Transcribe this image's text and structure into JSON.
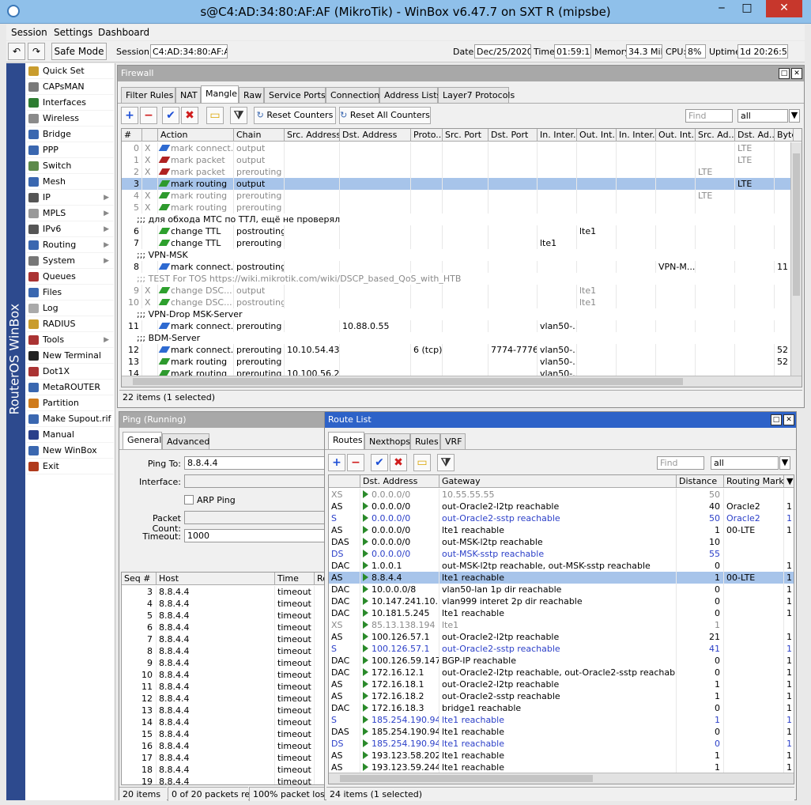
{
  "window": {
    "title": "s@C4:AD:34:80:AF:AF (MikroTik) - WinBox v6.47.7 on SXT R (mipsbe)"
  },
  "menu": [
    "Session",
    "Settings",
    "Dashboard"
  ],
  "toolbar": {
    "safe_mode": "Safe Mode",
    "session_label": "Session:",
    "session_value": "C4:AD:34:80:AF:AF",
    "date_label": "Date:",
    "date_value": "Dec/25/2020",
    "time_label": "Time:",
    "time_value": "01:59:14",
    "memory_label": "Memory:",
    "memory_value": "34.3 MiB",
    "cpu_label": "CPU:",
    "cpu_value": "8%",
    "uptime_label": "Uptime:",
    "uptime_value": "1d 20:26:52"
  },
  "sidebar": {
    "brand": "RouterOS WinBox",
    "items": [
      {
        "label": "Quick Set",
        "icon": "wand-icon",
        "color": "#c99c2d",
        "arrow": false
      },
      {
        "label": "CAPsMAN",
        "icon": "capsman-icon",
        "color": "#7a7a7a",
        "arrow": false
      },
      {
        "label": "Interfaces",
        "icon": "interfaces-icon",
        "color": "#2e7d32",
        "arrow": false
      },
      {
        "label": "Wireless",
        "icon": "wireless-icon",
        "color": "#8a8a8a",
        "arrow": false
      },
      {
        "label": "Bridge",
        "icon": "bridge-icon",
        "color": "#3a67b0",
        "arrow": false
      },
      {
        "label": "PPP",
        "icon": "ppp-icon",
        "color": "#3a67b0",
        "arrow": false
      },
      {
        "label": "Switch",
        "icon": "switch-icon",
        "color": "#5c8a4a",
        "arrow": false
      },
      {
        "label": "Mesh",
        "icon": "mesh-icon",
        "color": "#3a67b0",
        "arrow": false
      },
      {
        "label": "IP",
        "icon": "ip-icon",
        "color": "#555",
        "arrow": true
      },
      {
        "label": "MPLS",
        "icon": "mpls-icon",
        "color": "#999",
        "arrow": true
      },
      {
        "label": "IPv6",
        "icon": "ipv6-icon",
        "color": "#555",
        "arrow": true
      },
      {
        "label": "Routing",
        "icon": "routing-icon",
        "color": "#3a67b0",
        "arrow": true
      },
      {
        "label": "System",
        "icon": "system-icon",
        "color": "#777",
        "arrow": true
      },
      {
        "label": "Queues",
        "icon": "queues-icon",
        "color": "#a33",
        "arrow": false
      },
      {
        "label": "Files",
        "icon": "files-icon",
        "color": "#3a67b0",
        "arrow": false
      },
      {
        "label": "Log",
        "icon": "log-icon",
        "color": "#aaa",
        "arrow": false
      },
      {
        "label": "RADIUS",
        "icon": "radius-icon",
        "color": "#c99c2d",
        "arrow": false
      },
      {
        "label": "Tools",
        "icon": "tools-icon",
        "color": "#a33",
        "arrow": true
      },
      {
        "label": "New Terminal",
        "icon": "terminal-icon",
        "color": "#222",
        "arrow": false
      },
      {
        "label": "Dot1X",
        "icon": "dot1x-icon",
        "color": "#a33",
        "arrow": false
      },
      {
        "label": "MetaROUTER",
        "icon": "metarouter-icon",
        "color": "#3a67b0",
        "arrow": false
      },
      {
        "label": "Partition",
        "icon": "partition-icon",
        "color": "#d07b1c",
        "arrow": false
      },
      {
        "label": "Make Supout.rif",
        "icon": "supout-icon",
        "color": "#3a67b0",
        "arrow": false
      },
      {
        "label": "Manual",
        "icon": "manual-icon",
        "color": "#2a3f8a",
        "arrow": false
      },
      {
        "label": "New WinBox",
        "icon": "winbox-icon",
        "color": "#3a67b0",
        "arrow": false
      },
      {
        "label": "Exit",
        "icon": "exit-icon",
        "color": "#b03a1c",
        "arrow": false
      }
    ]
  },
  "firewall": {
    "title": "Firewall",
    "tabs": [
      "Filter Rules",
      "NAT",
      "Mangle",
      "Raw",
      "Service Ports",
      "Connections",
      "Address Lists",
      "Layer7 Protocols"
    ],
    "active_tab": "Mangle",
    "reset_counters": "Reset Counters",
    "reset_all_counters": "Reset All Counters",
    "find_placeholder": "Find",
    "filter_value": "all",
    "columns": [
      "#",
      "",
      "Action",
      "Chain",
      "Src. Address",
      "Dst. Address",
      "Proto...",
      "Src. Port",
      "Dst. Port",
      "In. Inter...",
      "Out. Int...",
      "In. Inter...",
      "Out. Int...",
      "Src. Ad...",
      "Dst. Ad...",
      "Byte"
    ],
    "rows": [
      {
        "type": "rule",
        "num": "0",
        "flag": "X",
        "action": "mark connect...",
        "chain": "output",
        "src": "",
        "dst": "",
        "proto": "",
        "sport": "",
        "dport": "",
        "inif": "",
        "outif": "",
        "inif2": "",
        "outif2": "",
        "srcl": "",
        "dstl": "LTE",
        "bytes": "",
        "state": "dis",
        "icon": "blue"
      },
      {
        "type": "rule",
        "num": "1",
        "flag": "X",
        "action": "mark packet",
        "chain": "output",
        "src": "",
        "dst": "",
        "proto": "",
        "sport": "",
        "dport": "",
        "inif": "",
        "outif": "",
        "inif2": "",
        "outif2": "",
        "srcl": "",
        "dstl": "LTE",
        "bytes": "",
        "state": "dis",
        "icon": "red"
      },
      {
        "type": "rule",
        "num": "2",
        "flag": "X",
        "action": "mark packet",
        "chain": "prerouting",
        "src": "",
        "dst": "",
        "proto": "",
        "sport": "",
        "dport": "",
        "inif": "",
        "outif": "",
        "inif2": "",
        "outif2": "",
        "srcl": "LTE",
        "dstl": "",
        "bytes": "",
        "state": "dis",
        "icon": "red"
      },
      {
        "type": "rule",
        "num": "3",
        "flag": "",
        "action": "mark routing",
        "chain": "output",
        "src": "",
        "dst": "",
        "proto": "",
        "sport": "",
        "dport": "",
        "inif": "",
        "outif": "",
        "inif2": "",
        "outif2": "",
        "srcl": "",
        "dstl": "LTE",
        "bytes": "",
        "state": "sel",
        "icon": "green"
      },
      {
        "type": "rule",
        "num": "4",
        "flag": "X",
        "action": "mark routing",
        "chain": "prerouting",
        "src": "",
        "dst": "",
        "proto": "",
        "sport": "",
        "dport": "",
        "inif": "",
        "outif": "",
        "inif2": "",
        "outif2": "",
        "srcl": "LTE",
        "dstl": "",
        "bytes": "",
        "state": "dis",
        "icon": "green"
      },
      {
        "type": "rule",
        "num": "5",
        "flag": "X",
        "action": "mark routing",
        "chain": "prerouting",
        "src": "",
        "dst": "",
        "proto": "",
        "sport": "",
        "dport": "",
        "inif": "",
        "outif": "",
        "inif2": "",
        "outif2": "",
        "srcl": "",
        "dstl": "",
        "bytes": "",
        "state": "dis",
        "icon": "green"
      },
      {
        "type": "comment",
        "text": ";;; для обхода МТС по ТТЛ, ещё не проверял",
        "state": ""
      },
      {
        "type": "rule",
        "num": "6",
        "flag": "",
        "action": "change TTL",
        "chain": "postrouting",
        "src": "",
        "dst": "",
        "proto": "",
        "sport": "",
        "dport": "",
        "inif": "",
        "outif": "lte1",
        "inif2": "",
        "outif2": "",
        "srcl": "",
        "dstl": "",
        "bytes": "",
        "state": "",
        "icon": "check"
      },
      {
        "type": "rule",
        "num": "7",
        "flag": "",
        "action": "change TTL",
        "chain": "prerouting",
        "src": "",
        "dst": "",
        "proto": "",
        "sport": "",
        "dport": "",
        "inif": "lte1",
        "outif": "",
        "inif2": "",
        "outif2": "",
        "srcl": "",
        "dstl": "",
        "bytes": "",
        "state": "",
        "icon": "check"
      },
      {
        "type": "comment",
        "text": ";;; VPN-MSK",
        "state": ""
      },
      {
        "type": "rule",
        "num": "8",
        "flag": "",
        "action": "mark connect...",
        "chain": "postrouting",
        "src": "",
        "dst": "",
        "proto": "",
        "sport": "",
        "dport": "",
        "inif": "",
        "outif": "",
        "inif2": "",
        "outif2": "VPN-M...",
        "srcl": "",
        "dstl": "",
        "bytes": "11",
        "state": "",
        "icon": "blue"
      },
      {
        "type": "comment",
        "text": ";;; TEST For TOS  https://wiki.mikrotik.com/wiki/DSCP_based_QoS_with_HTB",
        "state": "dis"
      },
      {
        "type": "rule",
        "num": "9",
        "flag": "X",
        "action": "change DSC...",
        "chain": "output",
        "src": "",
        "dst": "",
        "proto": "",
        "sport": "",
        "dport": "",
        "inif": "",
        "outif": "lte1",
        "inif2": "",
        "outif2": "",
        "srcl": "",
        "dstl": "",
        "bytes": "",
        "state": "dis",
        "icon": "check"
      },
      {
        "type": "rule",
        "num": "10",
        "flag": "X",
        "action": "change DSC...",
        "chain": "postrouting",
        "src": "",
        "dst": "",
        "proto": "",
        "sport": "",
        "dport": "",
        "inif": "",
        "outif": "lte1",
        "inif2": "",
        "outif2": "",
        "srcl": "",
        "dstl": "",
        "bytes": "",
        "state": "dis",
        "icon": "check"
      },
      {
        "type": "comment",
        "text": ";;; VPN-Drop MSK-Server",
        "state": ""
      },
      {
        "type": "rule",
        "num": "11",
        "flag": "",
        "action": "mark connect...",
        "chain": "prerouting",
        "src": "",
        "dst": "10.88.0.55",
        "proto": "",
        "sport": "",
        "dport": "",
        "inif": "vlan50-...",
        "outif": "",
        "inif2": "",
        "outif2": "",
        "srcl": "",
        "dstl": "",
        "bytes": "",
        "state": "",
        "icon": "blue"
      },
      {
        "type": "comment",
        "text": ";;; BDM-Server",
        "state": ""
      },
      {
        "type": "rule",
        "num": "12",
        "flag": "",
        "action": "mark connect...",
        "chain": "prerouting",
        "src": "10.10.54.43",
        "dst": "",
        "proto": "6 (tcp)",
        "sport": "",
        "dport": "7774-7776",
        "inif": "vlan50-...",
        "outif": "",
        "inif2": "",
        "outif2": "",
        "srcl": "",
        "dstl": "",
        "bytes": "52",
        "state": "",
        "icon": "blue"
      },
      {
        "type": "rule",
        "num": "13",
        "flag": "",
        "action": "mark routing",
        "chain": "prerouting",
        "src": "",
        "dst": "",
        "proto": "",
        "sport": "",
        "dport": "",
        "inif": "vlan50-...",
        "outif": "",
        "inif2": "",
        "outif2": "",
        "srcl": "",
        "dstl": "",
        "bytes": "52",
        "state": "",
        "icon": "green"
      },
      {
        "type": "rule",
        "num": "14",
        "flag": "",
        "action": "mark routing",
        "chain": "prerouting",
        "src": "10.100.56.25",
        "dst": "",
        "proto": "",
        "sport": "",
        "dport": "",
        "inif": "vlan50-...",
        "outif": "",
        "inif2": "",
        "outif2": "",
        "srcl": "",
        "dstl": "",
        "bytes": "",
        "state": "",
        "icon": "green"
      }
    ],
    "status": "22 items (1 selected)"
  },
  "ping": {
    "title": "Ping (Running)",
    "tabs": [
      "General",
      "Advanced"
    ],
    "ping_to_label": "Ping To:",
    "ping_to_value": "8.8.4.4",
    "interface_label": "Interface:",
    "interface_value": "",
    "arp_ping_label": "ARP Ping",
    "packet_count_label": "Packet Count:",
    "packet_count_value": "",
    "timeout_label": "Timeout:",
    "timeout_value": "1000",
    "columns": [
      "Seq #",
      "Host",
      "Time",
      "Re"
    ],
    "rows": [
      {
        "seq": "3",
        "host": "8.8.4.4",
        "time": "timeout"
      },
      {
        "seq": "4",
        "host": "8.8.4.4",
        "time": "timeout"
      },
      {
        "seq": "5",
        "host": "8.8.4.4",
        "time": "timeout"
      },
      {
        "seq": "6",
        "host": "8.8.4.4",
        "time": "timeout"
      },
      {
        "seq": "7",
        "host": "8.8.4.4",
        "time": "timeout"
      },
      {
        "seq": "8",
        "host": "8.8.4.4",
        "time": "timeout"
      },
      {
        "seq": "9",
        "host": "8.8.4.4",
        "time": "timeout"
      },
      {
        "seq": "10",
        "host": "8.8.4.4",
        "time": "timeout"
      },
      {
        "seq": "11",
        "host": "8.8.4.4",
        "time": "timeout"
      },
      {
        "seq": "12",
        "host": "8.8.4.4",
        "time": "timeout"
      },
      {
        "seq": "13",
        "host": "8.8.4.4",
        "time": "timeout"
      },
      {
        "seq": "14",
        "host": "8.8.4.4",
        "time": "timeout"
      },
      {
        "seq": "15",
        "host": "8.8.4.4",
        "time": "timeout"
      },
      {
        "seq": "16",
        "host": "8.8.4.4",
        "time": "timeout"
      },
      {
        "seq": "17",
        "host": "8.8.4.4",
        "time": "timeout"
      },
      {
        "seq": "18",
        "host": "8.8.4.4",
        "time": "timeout"
      },
      {
        "seq": "19",
        "host": "8.8.4.4",
        "time": "timeout"
      }
    ],
    "status_items": "20 items",
    "status_packets": "0 of 20 packets re...",
    "status_loss": "100% packet loss"
  },
  "routes": {
    "title": "Route List",
    "tabs": [
      "Routes",
      "Nexthops",
      "Rules",
      "VRF"
    ],
    "find_placeholder": "Find",
    "filter_value": "all",
    "columns": [
      "",
      "Dst. Address",
      "Gateway",
      "Distance",
      "Routing Mark"
    ],
    "rows": [
      {
        "flags": "XS",
        "dst": "0.0.0.0/0",
        "gw": "10.55.55.55",
        "dist": "50",
        "mark": "",
        "x": "",
        "state": "dis"
      },
      {
        "flags": "AS",
        "dst": "0.0.0.0/0",
        "gw": "out-Oracle2-l2tp reachable",
        "dist": "40",
        "mark": "Oracle2",
        "x": "1",
        "state": ""
      },
      {
        "flags": "S",
        "dst": "0.0.0.0/0",
        "gw": "out-Oracle2-sstp reachable",
        "dist": "50",
        "mark": "Oracle2",
        "x": "1",
        "state": "blue"
      },
      {
        "flags": "AS",
        "dst": "0.0.0.0/0",
        "gw": "lte1 reachable",
        "dist": "1",
        "mark": "00-LTE",
        "x": "1",
        "state": ""
      },
      {
        "flags": "DAS",
        "dst": "0.0.0.0/0",
        "gw": "out-MSK-l2tp reachable",
        "dist": "10",
        "mark": "",
        "x": "",
        "state": ""
      },
      {
        "flags": "DS",
        "dst": "0.0.0.0/0",
        "gw": "out-MSK-sstp reachable",
        "dist": "55",
        "mark": "",
        "x": "",
        "state": "blue"
      },
      {
        "flags": "DAC",
        "dst": "1.0.0.1",
        "gw": "out-MSK-l2tp reachable, out-MSK-sstp reachable",
        "dist": "0",
        "mark": "",
        "x": "1",
        "state": ""
      },
      {
        "flags": "AS",
        "dst": "8.8.4.4",
        "gw": "lte1 reachable",
        "dist": "1",
        "mark": "00-LTE",
        "x": "1",
        "state": "sel"
      },
      {
        "flags": "DAC",
        "dst": "10.0.0.0/8",
        "gw": "vlan50-lan 1p dir reachable",
        "dist": "0",
        "mark": "",
        "x": "1",
        "state": ""
      },
      {
        "flags": "DAC",
        "dst": "10.147.241.10...",
        "gw": "vlan999 interet 2p dir reachable",
        "dist": "0",
        "mark": "",
        "x": "1",
        "state": ""
      },
      {
        "flags": "DAC",
        "dst": "10.181.5.245",
        "gw": "lte1 reachable",
        "dist": "0",
        "mark": "",
        "x": "1",
        "state": ""
      },
      {
        "flags": "XS",
        "dst": "85.13.138.194",
        "gw": "lte1",
        "dist": "1",
        "mark": "",
        "x": "",
        "state": "dis"
      },
      {
        "flags": "AS",
        "dst": "100.126.57.1",
        "gw": "out-Oracle2-l2tp reachable",
        "dist": "21",
        "mark": "",
        "x": "1",
        "state": ""
      },
      {
        "flags": "S",
        "dst": "100.126.57.1",
        "gw": "out-Oracle2-sstp reachable",
        "dist": "41",
        "mark": "",
        "x": "1",
        "state": "blue"
      },
      {
        "flags": "DAC",
        "dst": "100.126.59.147",
        "gw": "BGP-IP reachable",
        "dist": "0",
        "mark": "",
        "x": "1",
        "state": ""
      },
      {
        "flags": "DAC",
        "dst": "172.16.12.1",
        "gw": "out-Oracle2-l2tp reachable, out-Oracle2-sstp reachable",
        "dist": "0",
        "mark": "",
        "x": "1",
        "state": ""
      },
      {
        "flags": "AS",
        "dst": "172.16.18.1",
        "gw": "out-Oracle2-l2tp reachable",
        "dist": "1",
        "mark": "",
        "x": "1",
        "state": ""
      },
      {
        "flags": "AS",
        "dst": "172.16.18.2",
        "gw": "out-Oracle2-sstp reachable",
        "dist": "1",
        "mark": "",
        "x": "1",
        "state": ""
      },
      {
        "flags": "DAC",
        "dst": "172.16.18.3",
        "gw": "bridge1 reachable",
        "dist": "0",
        "mark": "",
        "x": "1",
        "state": ""
      },
      {
        "flags": "S",
        "dst": "185.254.190.94",
        "gw": "lte1 reachable",
        "dist": "1",
        "mark": "",
        "x": "1",
        "state": "blue"
      },
      {
        "flags": "DAS",
        "dst": "185.254.190.94",
        "gw": "lte1 reachable",
        "dist": "0",
        "mark": "",
        "x": "1",
        "state": ""
      },
      {
        "flags": "DS",
        "dst": "185.254.190.94",
        "gw": "lte1 reachable",
        "dist": "0",
        "mark": "",
        "x": "1",
        "state": "blue"
      },
      {
        "flags": "AS",
        "dst": "193.123.58.202",
        "gw": "lte1 reachable",
        "dist": "1",
        "mark": "",
        "x": "1",
        "state": ""
      },
      {
        "flags": "AS",
        "dst": "193.123.59.244",
        "gw": "lte1 reachable",
        "dist": "1",
        "mark": "",
        "x": "1",
        "state": ""
      }
    ],
    "status": "24 items (1 selected)"
  }
}
